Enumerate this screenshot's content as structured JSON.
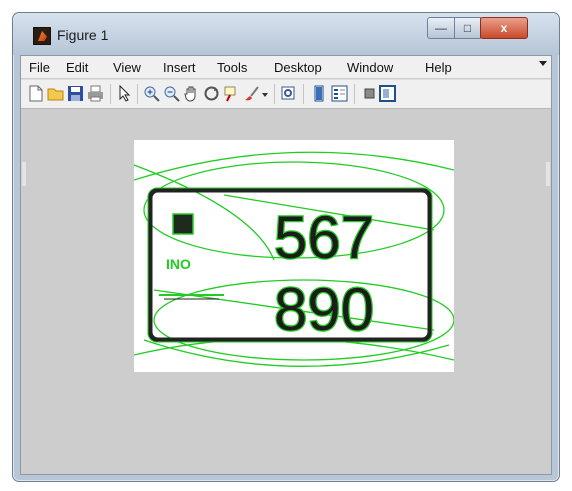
{
  "window": {
    "title": "Figure 1",
    "buttons": {
      "minimize": "—",
      "maximize": "□",
      "close": "x"
    }
  },
  "menubar": {
    "items": [
      "File",
      "Edit",
      "View",
      "Insert",
      "Tools",
      "Desktop",
      "Window",
      "Help"
    ]
  },
  "toolbar": {
    "icons": [
      "new-figure-icon",
      "open-file-icon",
      "save-icon",
      "print-icon",
      "select-pointer-icon",
      "zoom-in-icon",
      "zoom-out-icon",
      "pan-hand-icon",
      "rotate-3d-icon",
      "data-cursor-icon",
      "brush-icon",
      "link-plot-icon",
      "colorbar-icon",
      "legend-icon",
      "hide-plot-tools-icon",
      "show-plot-tools-icon"
    ]
  },
  "figure": {
    "plate_digits_top": "567",
    "plate_digits_bottom": "890",
    "plate_small_text": "INO",
    "detection_color": "#22cc22"
  }
}
